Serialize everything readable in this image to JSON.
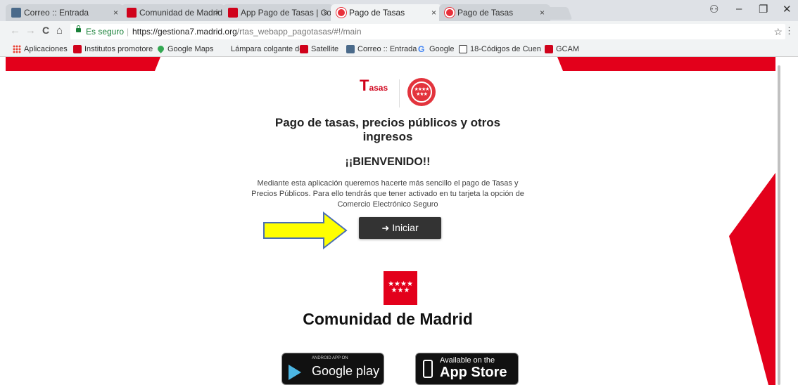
{
  "tabs": [
    {
      "title": "Correo :: Entrada",
      "icon": "mail-icon"
    },
    {
      "title": "Comunidad de Madrid",
      "icon": "madrid-favicon-icon"
    },
    {
      "title": "App Pago de Tasas | Com",
      "icon": "madrid-favicon-icon"
    },
    {
      "title": "Pago de Tasas",
      "icon": "tasas-favicon-icon",
      "active": true
    },
    {
      "title": "Pago de Tasas",
      "icon": "tasas-favicon-icon"
    }
  ],
  "tab_close": "×",
  "window": {
    "profile": "⚇",
    "minimize": "–",
    "restore": "❐",
    "close": "✕"
  },
  "nav": {
    "back": "←",
    "forward": "→",
    "reload": "C",
    "home": "⌂"
  },
  "address": {
    "secure_label": "Es seguro",
    "separator": "|",
    "host": "https://gestiona7.madrid.org",
    "path": "/rtas_webapp_pagotasas/#!/main",
    "star": "☆",
    "menu": "⋮"
  },
  "bookmarks": [
    {
      "label": "Aplicaciones",
      "icon": "apps-grid-icon"
    },
    {
      "label": "Institutos promotore",
      "icon": "madrid-favicon-icon"
    },
    {
      "label": "Google Maps",
      "icon": "maps-pin-icon"
    },
    {
      "label": "Lámpara colgante de",
      "icon": "none"
    },
    {
      "label": "Satellite",
      "icon": "madrid-favicon-icon"
    },
    {
      "label": "Correo :: Entrada",
      "icon": "mail-icon"
    },
    {
      "label": "Google",
      "icon": "google-icon"
    },
    {
      "label": "18-Códigos de Cuen",
      "icon": "pdf-icon"
    },
    {
      "label": "GCAM",
      "icon": "madrid-favicon-icon"
    }
  ],
  "page": {
    "logo_text_initial": "T",
    "logo_text_rest": "asas",
    "headline_line1": "Pago de tasas, precios públicos y otros",
    "headline_line2": "ingresos",
    "welcome": "¡¡BIENVENIDO!!",
    "intro_line1": "Mediante esta aplicación queremos hacerte más sencillo el pago de Tasas y",
    "intro_line2": "Precios Públicos. Para ello tendrás que tener activado en tu tarjeta la opción de",
    "intro_line3": "Comercio Electrónico Seguro",
    "start_button": "Iniciar",
    "flag_stars": "★★★★",
    "flag_stars2": "★★★",
    "org_name": "Comunidad de Madrid",
    "google_play_small": "ANDROID APP ON",
    "google_play_big": "Google play",
    "app_store_small": "Available on the",
    "app_store_big": "App Store"
  },
  "colors": {
    "brand_red": "#e3001b",
    "arrow_yellow": "#ffff00"
  }
}
